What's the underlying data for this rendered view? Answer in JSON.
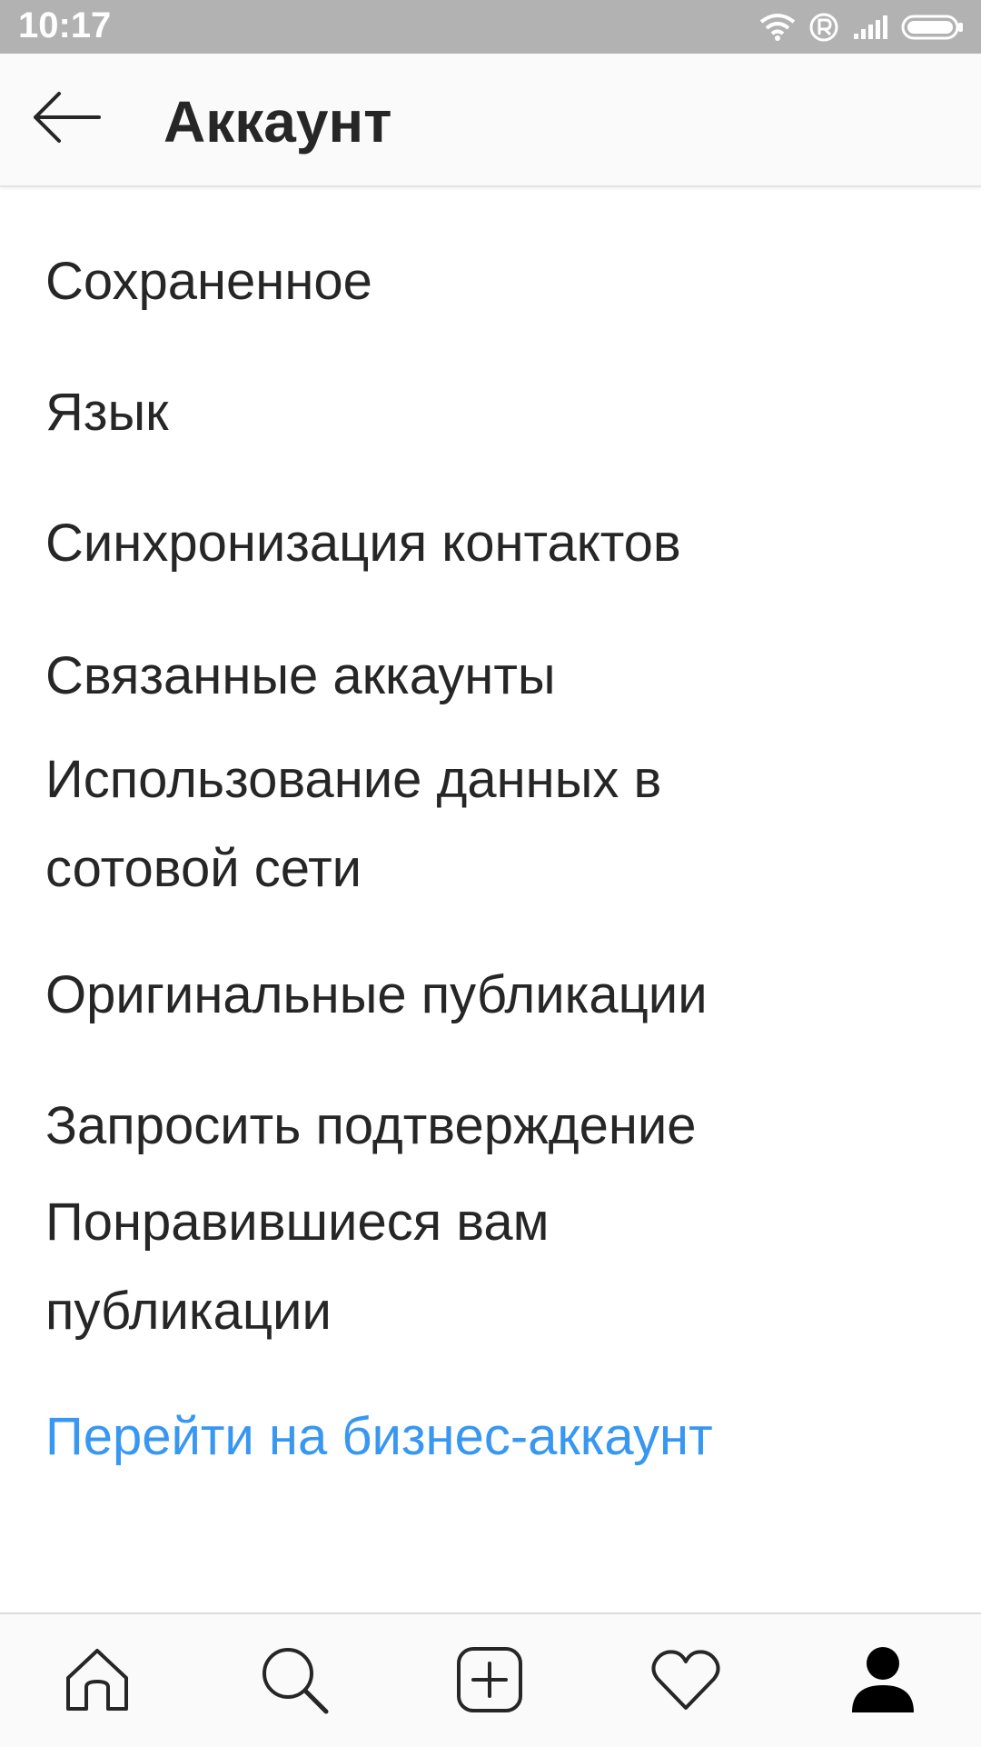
{
  "status_bar": {
    "time": "10:17"
  },
  "header": {
    "title": "Аккаунт"
  },
  "menu": {
    "items": [
      {
        "label": "Сохраненное"
      },
      {
        "label": "Язык"
      },
      {
        "label": "Синхронизация контактов"
      },
      {
        "label": "Связанные аккаунты"
      },
      {
        "label": "Использование данных в сотовой сети"
      },
      {
        "label": "Оригинальные публикации"
      },
      {
        "label": "Запросить подтверждение"
      },
      {
        "label": "Понравившиеся вам публикации"
      }
    ],
    "business_link": "Перейти на бизнес-аккаунт"
  },
  "colors": {
    "accent": "#3897f0",
    "text": "#262626",
    "status_bar": "#b2b2b2"
  },
  "bottom_nav": {
    "icons": [
      "home-icon",
      "search-icon",
      "add-post-icon",
      "heart-icon",
      "profile-icon"
    ]
  }
}
